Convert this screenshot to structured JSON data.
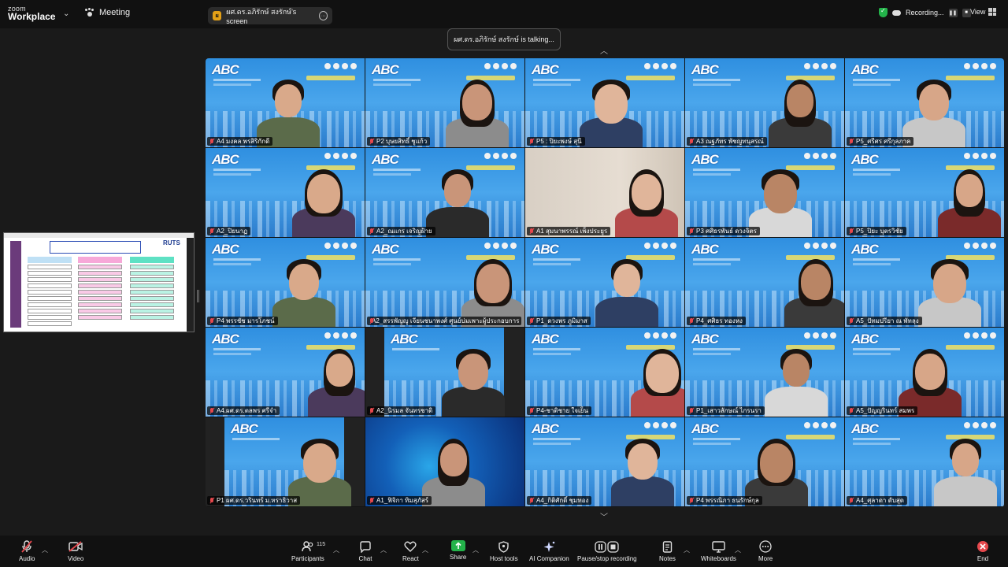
{
  "app": {
    "logo_line1": "zoom",
    "logo_line2": "Workplace",
    "meeting_label": "Meeting"
  },
  "share": {
    "badge": "ผ",
    "label": "ผศ.ดร.อภิรักษ์ สงรักษ์'s screen"
  },
  "status": {
    "recording": "Recording...",
    "view": "View"
  },
  "talking": "ผศ.ดร.อภิรักษ์ สงรักษ์ is talking...",
  "shared_content": {
    "brand": "RUTS"
  },
  "colors": {
    "accent_green": "#23b34a",
    "muted_red": "#e5484d",
    "share_green": "#23b34a"
  },
  "participants": [
    "A4 มงคล พรสิริกักดี",
    "P2 บุษยสิทธิ์ ชูแก้ว",
    "P5 : ปิยะพงษ์ สุนี",
    "A3 ณฐภัทร พัชญทนุสรณ์",
    "P5_ศรีศร ศรีกุลภาค",
    "A2_ปิยนาฏ",
    "A2_ณแกร เจริญฝ้าย",
    "A1 สุมนาพรรณ์ เพ็งประยูร",
    "P3 ศศิธรพันธ์ ดวงจิตร",
    "P5_ปิยะ บุตรวิชัย",
    "P4 พรรชัช มารโภชน์",
    "A2_สรรพัญญู เจียนชนาพงศ์ ศูนย์บ่มเพาะผู้ประกอบการ",
    "P1_ดวงพร ภูมิมาส",
    "P4_ศศิธร ทองหง",
    "A5_ปัทมปรียา ณ พัทลุง",
    "A4.ผศ.ดร.ตลพร ศรีจำ",
    "A2_นิรมล จันทรชาติ",
    "P4-ชาติชาย ใจเย็น",
    "P1_เสาวลักษณ์ ไกรนรา",
    "A5_ปัญญรินทร์ สมพร",
    "P1 ผศ.ดร.วรินทร์ ม.หราธิวาส",
    "A1_ฟิจิกา ทิมสุภัสร์",
    "A4_กิติศักดิ์ ชุมทอง",
    "P4 พรรณิภา ธนรักษ์กุล",
    "A4_ศุลาดา ดับสุด"
  ],
  "toolbar": {
    "audio": "Audio",
    "video": "Video",
    "participants": "Participants",
    "participant_count": "115",
    "chat": "Chat",
    "react": "React",
    "share": "Share",
    "host_tools": "Host tools",
    "ai_companion": "AI Companion",
    "pause_recording": "Pause/stop recording",
    "notes": "Notes",
    "whiteboards": "Whiteboards",
    "more": "More",
    "end": "End"
  },
  "icons": [
    "mic-muted-icon",
    "video-off-icon",
    "participants-icon",
    "chat-icon",
    "react-icon",
    "share-arrow-icon",
    "shield-icon",
    "sparkle-icon",
    "pause-icon",
    "notes-icon",
    "whiteboard-icon",
    "more-icon",
    "end-icon"
  ]
}
